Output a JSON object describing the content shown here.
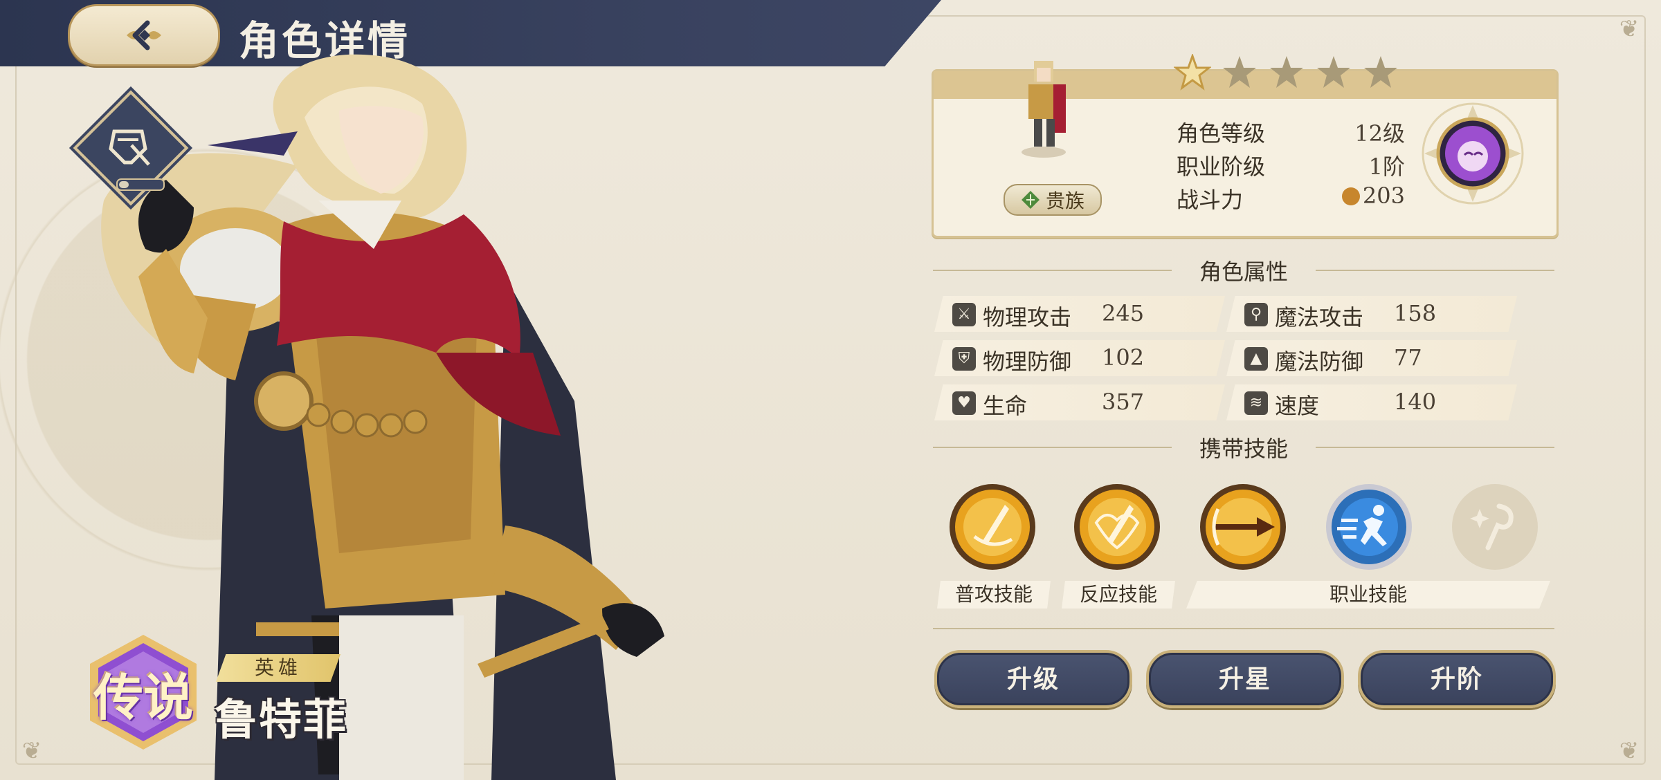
{
  "header": {
    "title": "角色详情"
  },
  "hero": {
    "rarity": "传说",
    "tag": "英雄",
    "name": "鲁特菲"
  },
  "info": {
    "stars_total": 5,
    "stars_filled": 1,
    "lineage": "贵族",
    "rows": [
      {
        "label": "角色等级",
        "value": "12级"
      },
      {
        "label": "职业阶级",
        "value": "1阶"
      },
      {
        "label": "战斗力",
        "value": "203"
      }
    ]
  },
  "attributes": {
    "title": "角色属性",
    "items": [
      {
        "name": "物理攻击",
        "value": "245",
        "icon": "sword-icon"
      },
      {
        "name": "魔法攻击",
        "value": "158",
        "icon": "wand-icon"
      },
      {
        "name": "物理防御",
        "value": "102",
        "icon": "shield-icon"
      },
      {
        "name": "魔法防御",
        "value": "77",
        "icon": "wizard-hat-icon"
      },
      {
        "name": "生命",
        "value": "357",
        "icon": "heart-icon"
      },
      {
        "name": "速度",
        "value": "140",
        "icon": "wing-icon"
      }
    ]
  },
  "skills": {
    "title": "携带技能",
    "labels": {
      "basic": "普攻技能",
      "reaction": "反应技能",
      "class": "职业技能"
    },
    "items": [
      {
        "icon": "flaming-sword-icon",
        "state": "equipped"
      },
      {
        "icon": "flaming-sword-icon",
        "state": "equipped"
      },
      {
        "icon": "spear-strike-icon",
        "state": "equipped"
      },
      {
        "icon": "running-figure-icon",
        "state": "equipped"
      },
      {
        "icon": "staff-sparkle-icon",
        "state": "locked"
      }
    ]
  },
  "actions": {
    "upgrade": "升级",
    "star_up": "升星",
    "rank_up": "升阶"
  },
  "colors": {
    "navy": "#39425f",
    "gold": "#c9b17a",
    "parchment": "#ece6d8"
  }
}
